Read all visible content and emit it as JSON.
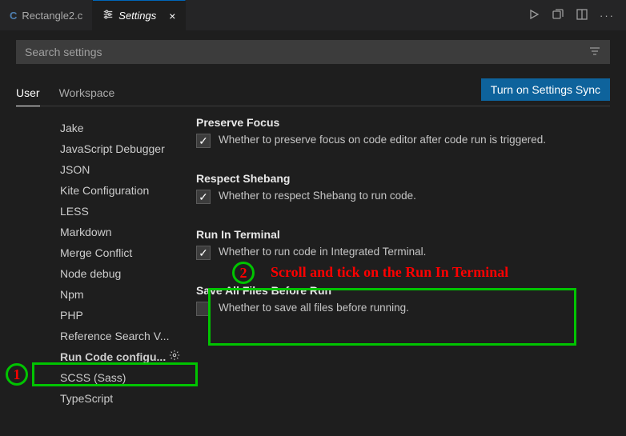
{
  "tabs": {
    "inactive": {
      "icon": "C",
      "label": "Rectangle2.c"
    },
    "active": {
      "label": "Settings"
    }
  },
  "search": {
    "placeholder": "Search settings"
  },
  "scopes": {
    "user": "User",
    "workspace": "Workspace"
  },
  "sync_button": "Turn on Settings Sync",
  "sidebar": {
    "items": [
      "Jake",
      "JavaScript Debugger",
      "JSON",
      "Kite Configuration",
      "LESS",
      "Markdown",
      "Merge Conflict",
      "Node debug",
      "Npm",
      "PHP",
      "Reference Search V...",
      "Run Code configu...",
      "SCSS (Sass)",
      "TypeScript"
    ]
  },
  "settings": {
    "preserve_focus": {
      "title": "Preserve Focus",
      "desc": "Whether to preserve focus on code editor after code run is triggered."
    },
    "respect_shebang": {
      "title": "Respect Shebang",
      "desc": "Whether to respect Shebang to run code."
    },
    "run_in_terminal": {
      "title": "Run In Terminal",
      "desc": "Whether to run code in Integrated Terminal."
    },
    "save_all": {
      "title": "Save All Files Before Run",
      "desc": "Whether to save all files before running."
    }
  },
  "annotations": {
    "n1": "1",
    "n2": "2",
    "text": "Scroll and tick on the Run In Terminal"
  }
}
